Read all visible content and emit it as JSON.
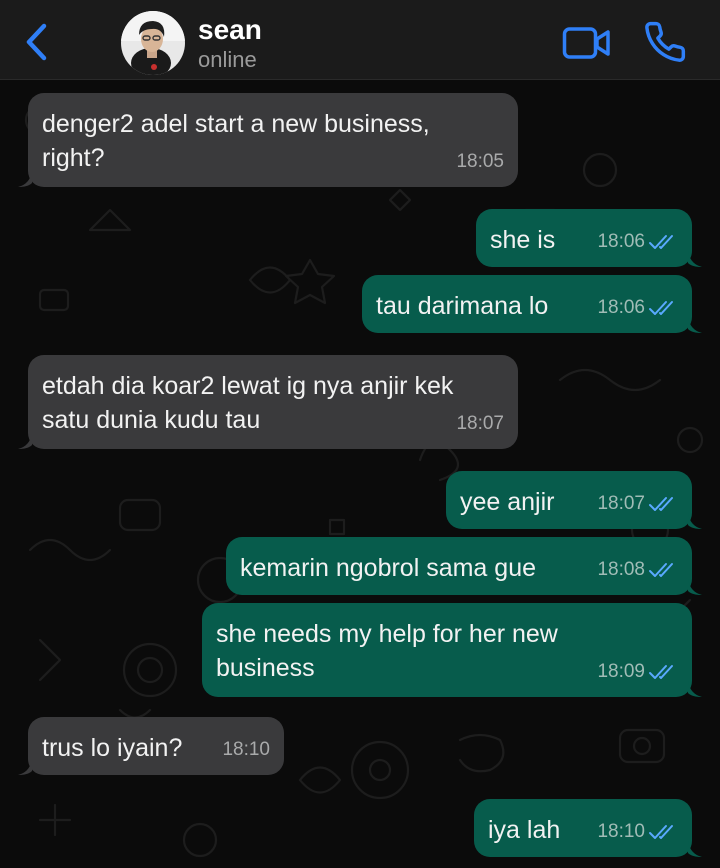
{
  "header": {
    "contact_name": "sean",
    "contact_status": "online",
    "accent_color": "#2f7ff7",
    "icons": [
      "chevron-left-icon",
      "video-call-icon",
      "phone-icon"
    ]
  },
  "colors": {
    "incoming_bubble": "#3a3a3c",
    "outgoing_bubble": "#075c4c",
    "read_receipt": "#5aa9ff"
  },
  "messages": [
    {
      "direction": "incoming",
      "text": "denger2 adel start a new business,\nright?",
      "time": "18:05"
    },
    {
      "direction": "outgoing",
      "text": "she is",
      "time": "18:06",
      "status": "read"
    },
    {
      "direction": "outgoing",
      "text": "tau darimana lo",
      "time": "18:06",
      "status": "read"
    },
    {
      "direction": "incoming",
      "text": "etdah dia koar2 lewat ig nya anjir kek\nsatu dunia kudu tau",
      "time": "18:07"
    },
    {
      "direction": "outgoing",
      "text": "yee anjir",
      "time": "18:07",
      "status": "read"
    },
    {
      "direction": "outgoing",
      "text": "kemarin ngobrol sama gue",
      "time": "18:08",
      "status": "read"
    },
    {
      "direction": "outgoing",
      "text": "she needs my help for her new\nbusiness",
      "time": "18:09",
      "status": "read"
    },
    {
      "direction": "incoming",
      "text": "trus lo iyain?",
      "time": "18:10"
    },
    {
      "direction": "outgoing",
      "text": "iya lah",
      "time": "18:10",
      "status": "read"
    }
  ]
}
